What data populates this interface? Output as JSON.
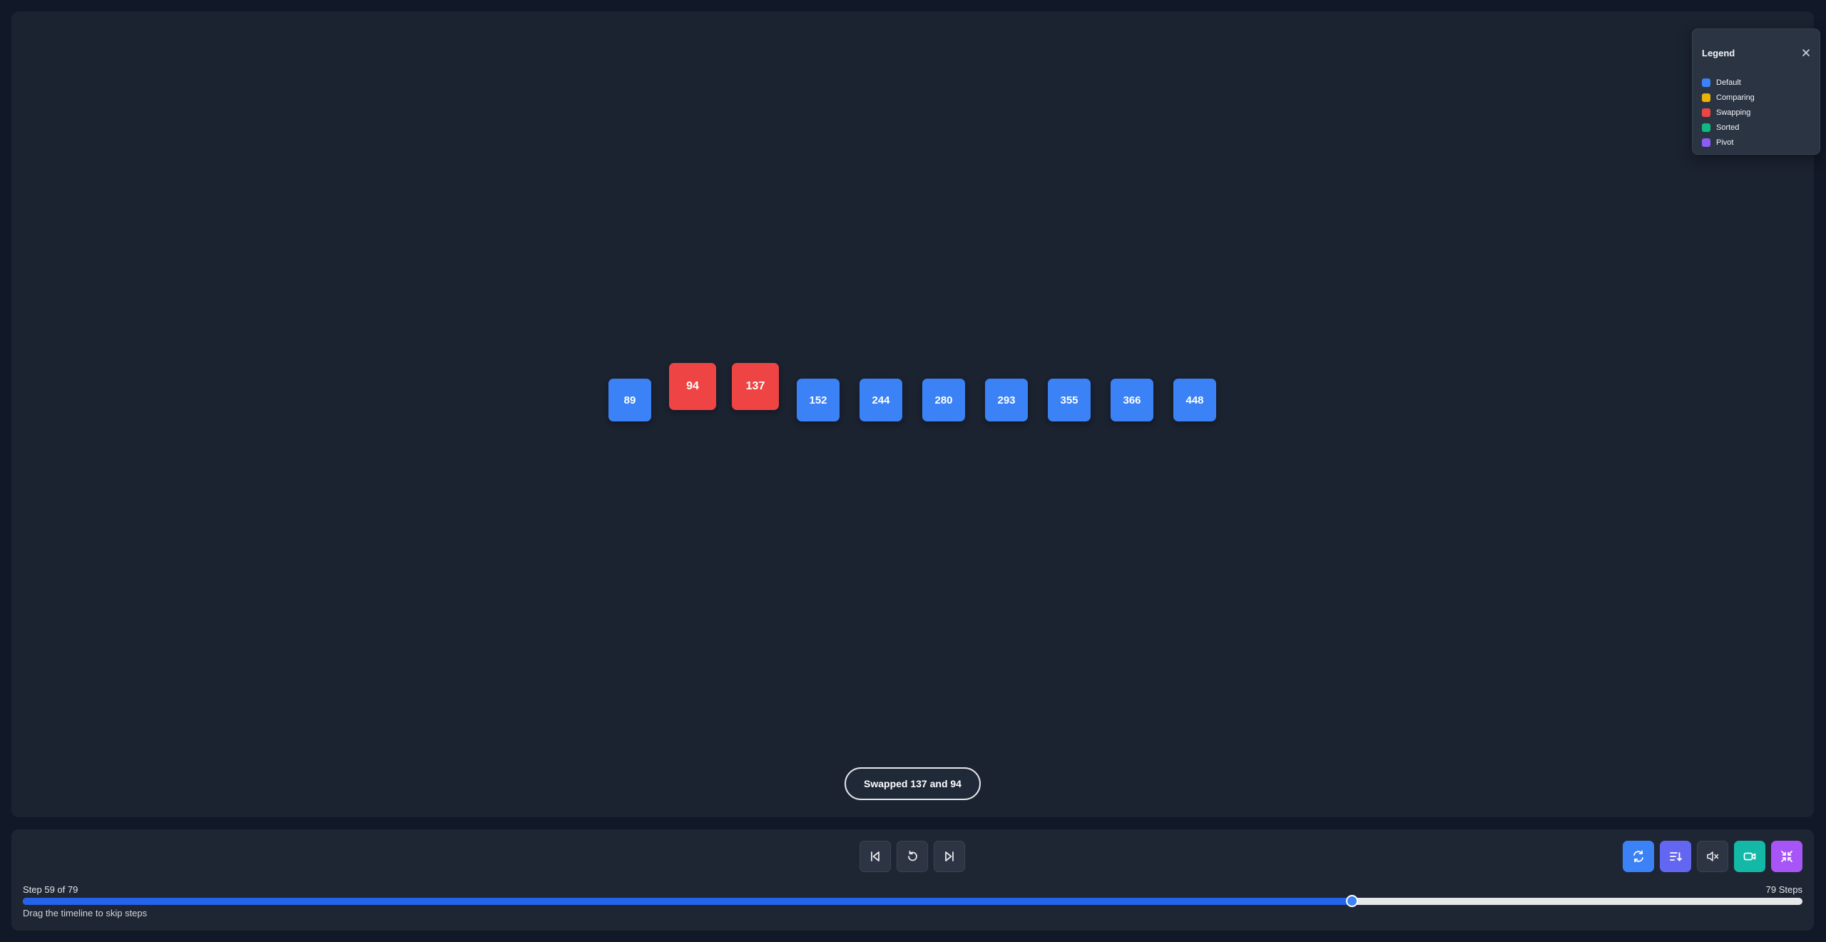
{
  "legend": {
    "title": "Legend",
    "items": [
      {
        "label": "Default",
        "color": "#3b82f6"
      },
      {
        "label": "Comparing",
        "color": "#eab308"
      },
      {
        "label": "Swapping",
        "color": "#ef4444"
      },
      {
        "label": "Sorted",
        "color": "#10b981"
      },
      {
        "label": "Pivot",
        "color": "#8b5cf6"
      }
    ]
  },
  "array": [
    {
      "value": "89",
      "state": "default"
    },
    {
      "value": "94",
      "state": "swapping"
    },
    {
      "value": "137",
      "state": "swapping"
    },
    {
      "value": "152",
      "state": "default"
    },
    {
      "value": "244",
      "state": "default"
    },
    {
      "value": "280",
      "state": "default"
    },
    {
      "value": "293",
      "state": "default"
    },
    {
      "value": "355",
      "state": "default"
    },
    {
      "value": "366",
      "state": "default"
    },
    {
      "value": "448",
      "state": "default"
    }
  ],
  "status": "Swapped 137 and 94",
  "timeline": {
    "step_label": "Step 59 of 79",
    "total_label": "79 Steps",
    "hint": "Drag the timeline to skip steps",
    "current_step": 59,
    "total_steps": 79
  },
  "colors": {
    "accent": "#2563eb",
    "shuffle": "#3b82f6",
    "sort": "#6366f1",
    "record": "#14b8a6",
    "fullscreen": "#a855f7"
  }
}
